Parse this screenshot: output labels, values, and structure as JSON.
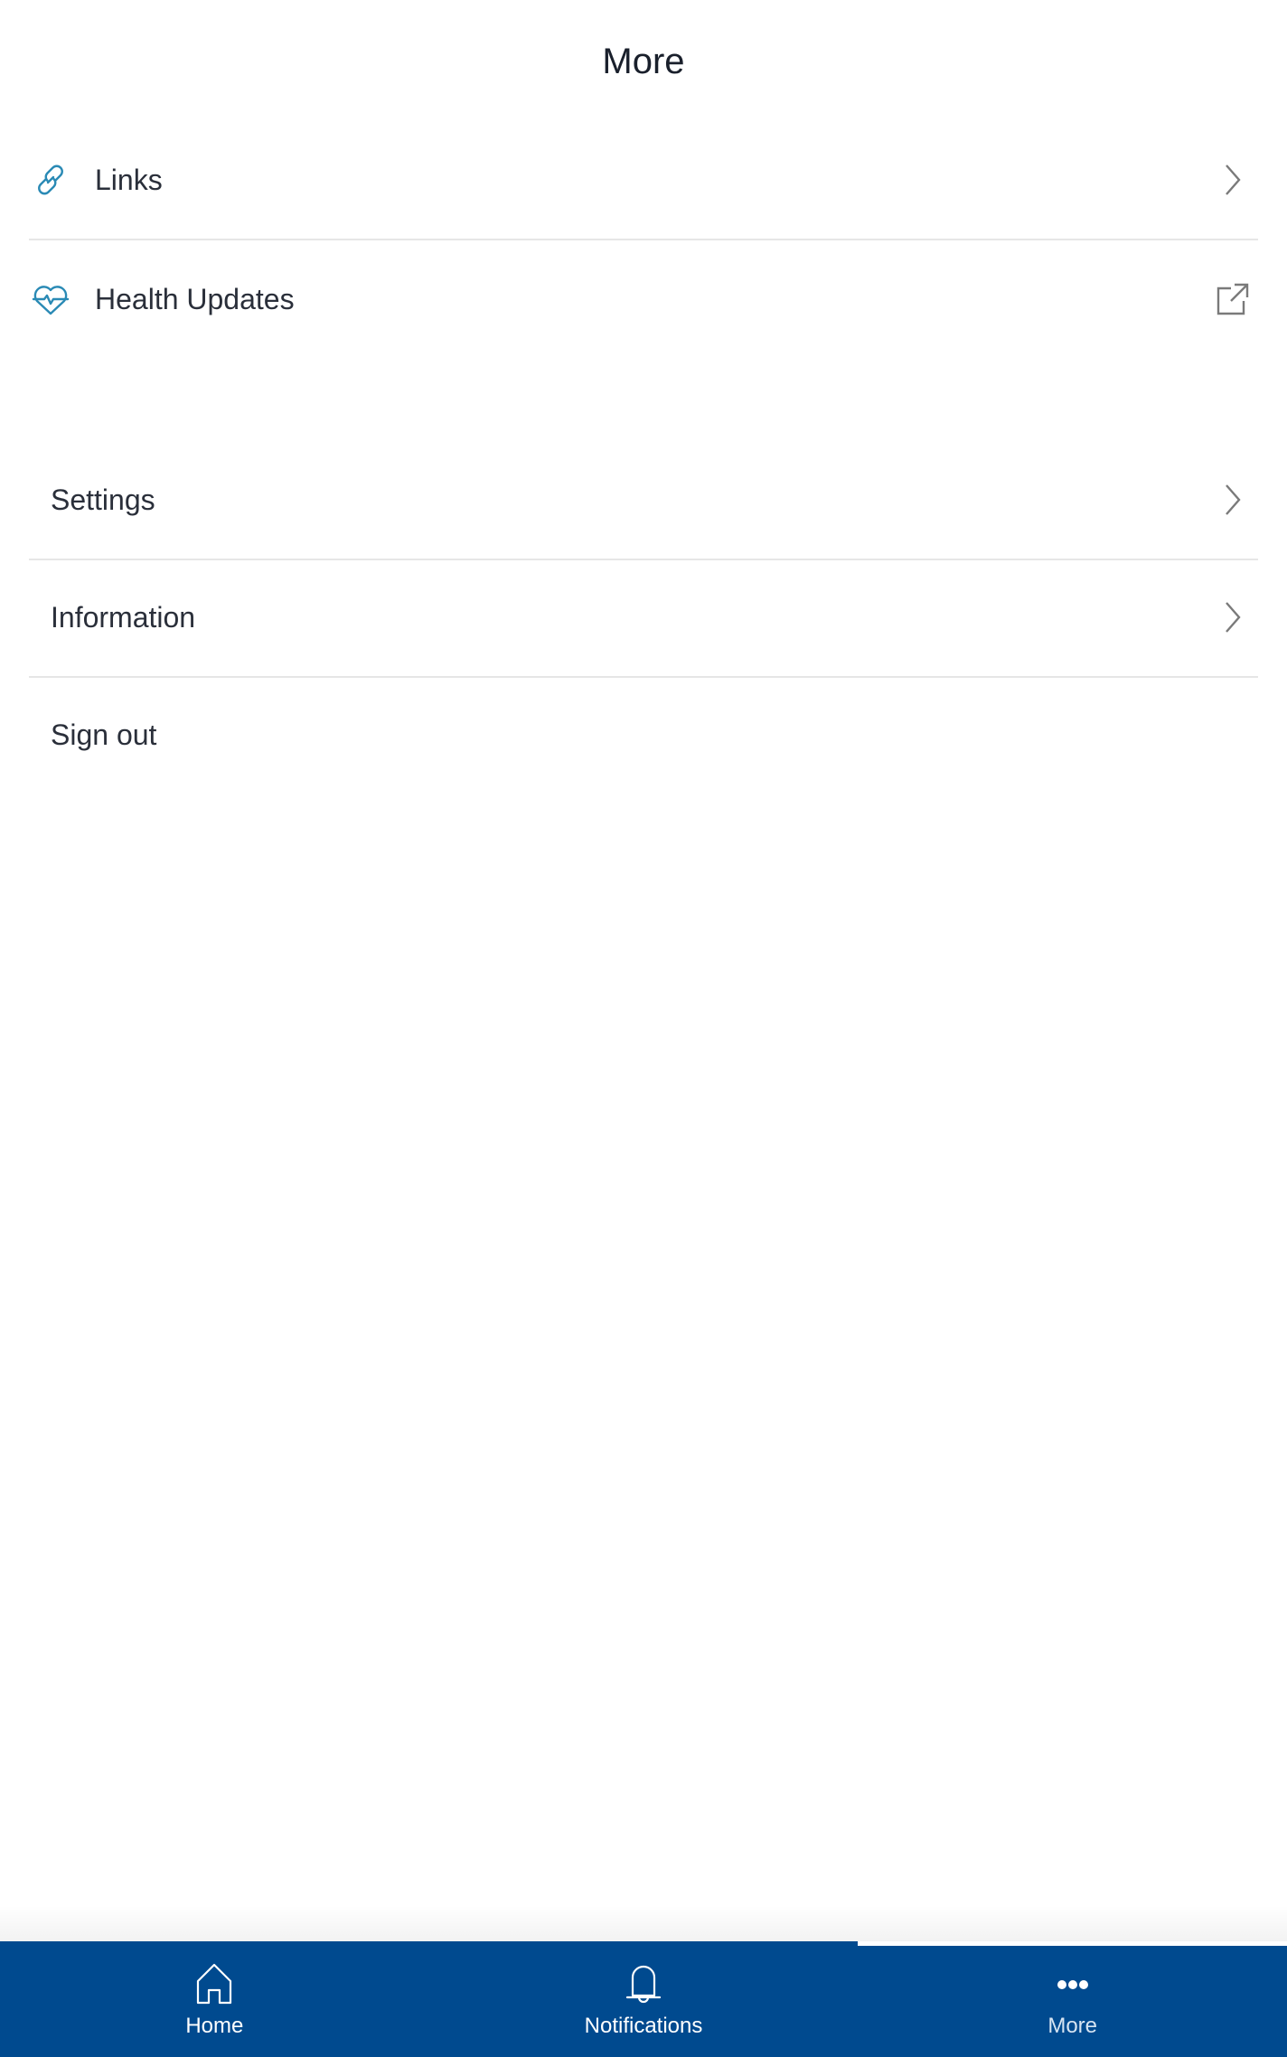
{
  "header": {
    "title": "More"
  },
  "colors": {
    "accent_icon": "#2a8ab5",
    "nav_background": "#004a8f",
    "chevron": "#7a7a7a"
  },
  "menu_top": [
    {
      "label": "Links",
      "left_icon": "link-icon",
      "right_icon": "chevron-right-icon"
    },
    {
      "label": "Health Updates",
      "left_icon": "heart-pulse-icon",
      "right_icon": "external-link-icon"
    }
  ],
  "menu_bottom": [
    {
      "label": "Settings",
      "right_icon": "chevron-right-icon"
    },
    {
      "label": "Information",
      "right_icon": "chevron-right-icon"
    },
    {
      "label": "Sign out"
    }
  ],
  "bottom_nav": {
    "items": [
      {
        "label": "Home",
        "icon": "home-icon",
        "active": false
      },
      {
        "label": "Notifications",
        "icon": "bell-icon",
        "active": false
      },
      {
        "label": "More",
        "icon": "more-dots-icon",
        "active": true
      }
    ]
  }
}
